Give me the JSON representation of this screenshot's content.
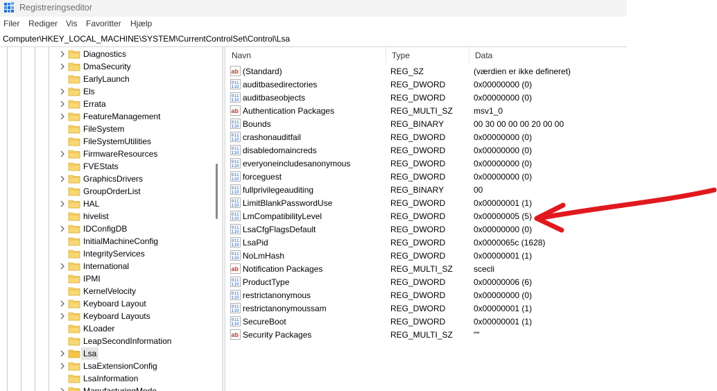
{
  "window": {
    "title": "Registreringseditor",
    "address": "Computer\\HKEY_LOCAL_MACHINE\\SYSTEM\\CurrentControlSet\\Control\\Lsa"
  },
  "menu": [
    "Filer",
    "Rediger",
    "Vis",
    "Favoritter",
    "Hjælp"
  ],
  "tree": {
    "items": [
      {
        "label": "Diagnostics",
        "expandable": true
      },
      {
        "label": "DmaSecurity",
        "expandable": true
      },
      {
        "label": "EarlyLaunch",
        "expandable": false
      },
      {
        "label": "Els",
        "expandable": true
      },
      {
        "label": "Errata",
        "expandable": true
      },
      {
        "label": "FeatureManagement",
        "expandable": true
      },
      {
        "label": "FileSystem",
        "expandable": false
      },
      {
        "label": "FileSystemUtilities",
        "expandable": false
      },
      {
        "label": "FirmwareResources",
        "expandable": true
      },
      {
        "label": "FVEStats",
        "expandable": false
      },
      {
        "label": "GraphicsDrivers",
        "expandable": true
      },
      {
        "label": "GroupOrderList",
        "expandable": false
      },
      {
        "label": "HAL",
        "expandable": true
      },
      {
        "label": "hivelist",
        "expandable": false
      },
      {
        "label": "IDConfigDB",
        "expandable": true
      },
      {
        "label": "InitialMachineConfig",
        "expandable": false
      },
      {
        "label": "IntegrityServices",
        "expandable": false
      },
      {
        "label": "International",
        "expandable": true
      },
      {
        "label": "IPMI",
        "expandable": false
      },
      {
        "label": "KernelVelocity",
        "expandable": false
      },
      {
        "label": "Keyboard Layout",
        "expandable": true
      },
      {
        "label": "Keyboard Layouts",
        "expandable": true
      },
      {
        "label": "KLoader",
        "expandable": false
      },
      {
        "label": "LeapSecondInformation",
        "expandable": false
      },
      {
        "label": "Lsa",
        "expandable": true,
        "selected": true
      },
      {
        "label": "LsaExtensionConfig",
        "expandable": true
      },
      {
        "label": "LsaInformation",
        "expandable": false
      },
      {
        "label": "ManufacturingMode",
        "expandable": true
      }
    ]
  },
  "columns": {
    "name": "Navn",
    "type": "Type",
    "data": "Data"
  },
  "values": [
    {
      "icon": "string-value-icon",
      "name": "(Standard)",
      "type": "REG_SZ",
      "data": "(værdien er ikke defineret)"
    },
    {
      "icon": "binary-value-icon",
      "name": "auditbasedirectories",
      "type": "REG_DWORD",
      "data": "0x00000000 (0)"
    },
    {
      "icon": "binary-value-icon",
      "name": "auditbaseobjects",
      "type": "REG_DWORD",
      "data": "0x00000000 (0)"
    },
    {
      "icon": "string-value-icon",
      "name": "Authentication Packages",
      "type": "REG_MULTI_SZ",
      "data": "msv1_0"
    },
    {
      "icon": "binary-value-icon",
      "name": "Bounds",
      "type": "REG_BINARY",
      "data": "00 30 00 00 00 20 00 00"
    },
    {
      "icon": "binary-value-icon",
      "name": "crashonauditfail",
      "type": "REG_DWORD",
      "data": "0x00000000 (0)"
    },
    {
      "icon": "binary-value-icon",
      "name": "disabledomaincreds",
      "type": "REG_DWORD",
      "data": "0x00000000 (0)"
    },
    {
      "icon": "binary-value-icon",
      "name": "everyoneincludesanonymous",
      "type": "REG_DWORD",
      "data": "0x00000000 (0)"
    },
    {
      "icon": "binary-value-icon",
      "name": "forceguest",
      "type": "REG_DWORD",
      "data": "0x00000000 (0)"
    },
    {
      "icon": "binary-value-icon",
      "name": "fullprivilegeauditing",
      "type": "REG_BINARY",
      "data": "00"
    },
    {
      "icon": "binary-value-icon",
      "name": "LimitBlankPasswordUse",
      "type": "REG_DWORD",
      "data": "0x00000001 (1)"
    },
    {
      "icon": "binary-value-icon",
      "name": "LmCompatibilityLevel",
      "type": "REG_DWORD",
      "data": "0x00000005 (5)"
    },
    {
      "icon": "binary-value-icon",
      "name": "LsaCfgFlagsDefault",
      "type": "REG_DWORD",
      "data": "0x00000000 (0)"
    },
    {
      "icon": "binary-value-icon",
      "name": "LsaPid",
      "type": "REG_DWORD",
      "data": "0x0000065c (1628)"
    },
    {
      "icon": "binary-value-icon",
      "name": "NoLmHash",
      "type": "REG_DWORD",
      "data": "0x00000001 (1)"
    },
    {
      "icon": "string-value-icon",
      "name": "Notification Packages",
      "type": "REG_MULTI_SZ",
      "data": "scecli"
    },
    {
      "icon": "binary-value-icon",
      "name": "ProductType",
      "type": "REG_DWORD",
      "data": "0x00000006 (6)"
    },
    {
      "icon": "binary-value-icon",
      "name": "restrictanonymous",
      "type": "REG_DWORD",
      "data": "0x00000000 (0)"
    },
    {
      "icon": "binary-value-icon",
      "name": "restrictanonymoussam",
      "type": "REG_DWORD",
      "data": "0x00000001 (1)"
    },
    {
      "icon": "binary-value-icon",
      "name": "SecureBoot",
      "type": "REG_DWORD",
      "data": "0x00000001 (1)"
    },
    {
      "icon": "string-value-icon",
      "name": "Security Packages",
      "type": "REG_MULTI_SZ",
      "data": "\"\""
    }
  ],
  "annotation": {
    "color": "#e0191e"
  }
}
